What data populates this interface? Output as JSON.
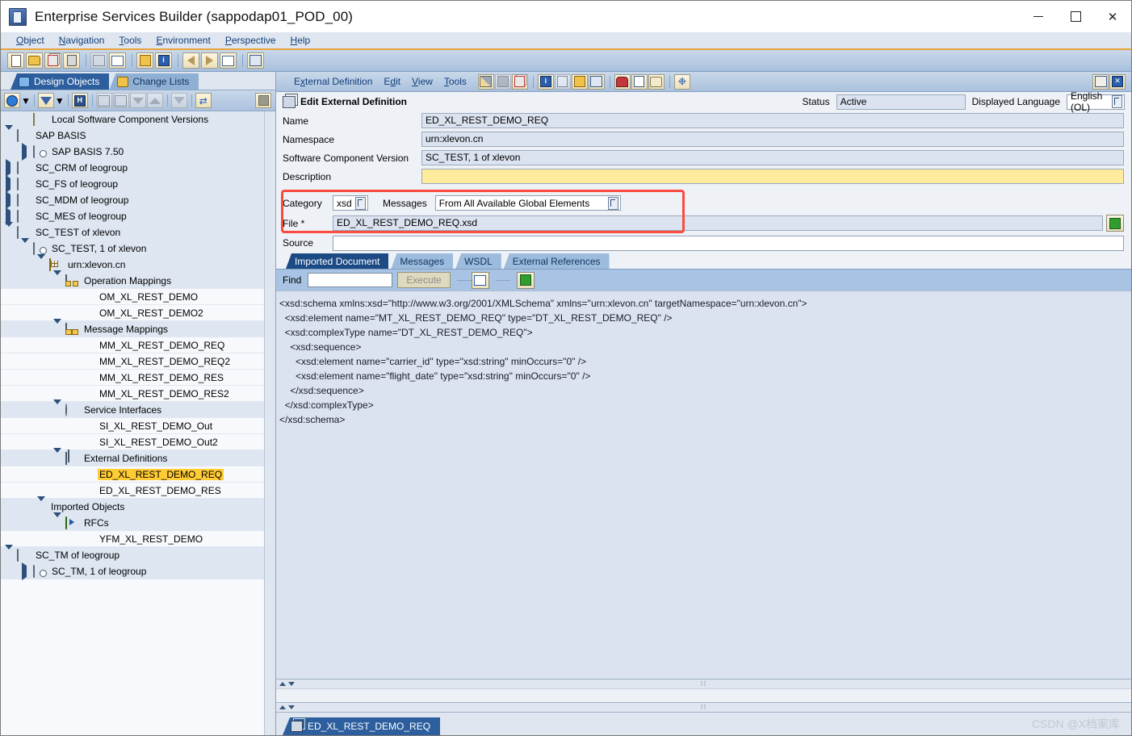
{
  "window": {
    "title": "Enterprise Services Builder (sappodap01_POD_00)",
    "minimize_label": "—",
    "maximize_label": "□",
    "close_label": "✕"
  },
  "menubar": {
    "items": [
      {
        "label": "Object",
        "accel": "O"
      },
      {
        "label": "Navigation",
        "accel": "N"
      },
      {
        "label": "Tools",
        "accel": "T"
      },
      {
        "label": "Environment",
        "accel": "E"
      },
      {
        "label": "Perspective",
        "accel": "P"
      },
      {
        "label": "Help",
        "accel": "H"
      }
    ]
  },
  "main_toolbar": {
    "buttons": [
      {
        "name": "new-icon",
        "enabled": true
      },
      {
        "name": "open-folder-icon",
        "enabled": true
      },
      {
        "name": "copy-icon",
        "enabled": true
      },
      {
        "name": "delete-trash-icon",
        "enabled": true
      },
      {
        "name": "save-all-icon",
        "enabled": false
      },
      {
        "name": "check-document-icon",
        "enabled": true
      },
      {
        "name": "where-used-icon",
        "enabled": true
      },
      {
        "name": "object-info-icon",
        "enabled": true
      },
      {
        "name": "back-arrow-icon",
        "enabled": true
      },
      {
        "name": "forward-arrow-icon",
        "enabled": true
      },
      {
        "name": "history-list-icon",
        "enabled": true
      },
      {
        "name": "cache-notification-icon",
        "enabled": true
      }
    ]
  },
  "left_panel": {
    "tabs": [
      {
        "label": "Design Objects",
        "active": true,
        "icon": "design-objects-icon"
      },
      {
        "label": "Change Lists",
        "active": false,
        "icon": "change-lists-icon"
      }
    ],
    "toolbar": [
      {
        "name": "refresh-icon",
        "enabled": true,
        "has_dropdown": true
      },
      {
        "name": "filter-icon",
        "enabled": true,
        "has_dropdown": true
      },
      {
        "name": "find-icon",
        "enabled": true
      },
      {
        "name": "expand-subtree-icon",
        "enabled": false
      },
      {
        "name": "collapse-subtree-icon",
        "enabled": false
      },
      {
        "name": "expand-all-icon",
        "enabled": false
      },
      {
        "name": "collapse-all-icon",
        "enabled": false
      },
      {
        "name": "apply-filter-icon",
        "enabled": false
      },
      {
        "name": "sync-navigation-icon",
        "enabled": true
      },
      {
        "name": "stop-icon",
        "enabled": false
      }
    ],
    "tree": [
      {
        "label": "Local Software Component Versions",
        "indent": 1,
        "arrow": "none",
        "icon": "software-stack-icon",
        "band": true
      },
      {
        "label": "SAP BASIS",
        "indent": 0,
        "arrow": "open",
        "icon": "software-component-icon",
        "band": true
      },
      {
        "label": "SAP BASIS 7.50",
        "indent": 1,
        "arrow": "closed",
        "icon": "scv-icon",
        "band": true
      },
      {
        "label": "SC_CRM of leogroup",
        "indent": 0,
        "arrow": "closed",
        "icon": "software-component-icon",
        "band": true
      },
      {
        "label": "SC_FS of leogroup",
        "indent": 0,
        "arrow": "closed",
        "icon": "software-component-icon",
        "band": true
      },
      {
        "label": "SC_MDM of leogroup",
        "indent": 0,
        "arrow": "closed",
        "icon": "software-component-icon",
        "band": true
      },
      {
        "label": "SC_MES of leogroup",
        "indent": 0,
        "arrow": "closed",
        "icon": "software-component-icon",
        "band": true
      },
      {
        "label": "SC_TEST of xlevon",
        "indent": 0,
        "arrow": "open",
        "icon": "software-component-icon",
        "band": true
      },
      {
        "label": "SC_TEST, 1 of xlevon",
        "indent": 1,
        "arrow": "open",
        "icon": "scv-icon",
        "band": true
      },
      {
        "label": "urn:xlevon.cn",
        "indent": 2,
        "arrow": "open",
        "icon": "namespace-icon",
        "band": true
      },
      {
        "label": "Operation Mappings",
        "indent": 3,
        "arrow": "open",
        "icon": "operation-mappings-icon",
        "band": true
      },
      {
        "label": "OM_XL_REST_DEMO",
        "indent": 5,
        "arrow": "none",
        "icon": "none",
        "band": false
      },
      {
        "label": "OM_XL_REST_DEMO2",
        "indent": 5,
        "arrow": "none",
        "icon": "none",
        "band": false
      },
      {
        "label": "Message Mappings",
        "indent": 3,
        "arrow": "open",
        "icon": "message-mappings-icon",
        "band": true
      },
      {
        "label": "MM_XL_REST_DEMO_REQ",
        "indent": 5,
        "arrow": "none",
        "icon": "none",
        "band": false
      },
      {
        "label": "MM_XL_REST_DEMO_REQ2",
        "indent": 5,
        "arrow": "none",
        "icon": "none",
        "band": false
      },
      {
        "label": "MM_XL_REST_DEMO_RES",
        "indent": 5,
        "arrow": "none",
        "icon": "none",
        "band": false
      },
      {
        "label": "MM_XL_REST_DEMO_RES2",
        "indent": 5,
        "arrow": "none",
        "icon": "none",
        "band": false
      },
      {
        "label": "Service Interfaces",
        "indent": 3,
        "arrow": "open",
        "icon": "service-interfaces-icon",
        "band": true
      },
      {
        "label": "SI_XL_REST_DEMO_Out",
        "indent": 5,
        "arrow": "none",
        "icon": "none",
        "band": false
      },
      {
        "label": "SI_XL_REST_DEMO_Out2",
        "indent": 5,
        "arrow": "none",
        "icon": "none",
        "band": false
      },
      {
        "label": "External Definitions",
        "indent": 3,
        "arrow": "open",
        "icon": "external-definitions-icon",
        "band": true
      },
      {
        "label": "ED_XL_REST_DEMO_REQ",
        "indent": 5,
        "arrow": "none",
        "icon": "none",
        "band": false,
        "selected": true
      },
      {
        "label": "ED_XL_REST_DEMO_RES",
        "indent": 5,
        "arrow": "none",
        "icon": "none",
        "band": false
      },
      {
        "label": "Imported Objects",
        "indent": 2,
        "arrow": "open",
        "icon": "none",
        "band": true
      },
      {
        "label": "RFCs",
        "indent": 3,
        "arrow": "open",
        "icon": "rfc-icon",
        "band": true
      },
      {
        "label": "YFM_XL_REST_DEMO",
        "indent": 5,
        "arrow": "none",
        "icon": "none",
        "band": false
      },
      {
        "label": "SC_TM of leogroup",
        "indent": 0,
        "arrow": "open",
        "icon": "software-component-icon",
        "band": true
      },
      {
        "label": "SC_TM, 1 of leogroup",
        "indent": 1,
        "arrow": "closed",
        "icon": "scv-icon",
        "band": true
      }
    ]
  },
  "editor": {
    "menu": [
      {
        "label": "External Definition",
        "accel": "x"
      },
      {
        "label": "Edit",
        "accel": "d"
      },
      {
        "label": "View",
        "accel": "V"
      },
      {
        "label": "Tools",
        "accel": "T"
      }
    ],
    "toolbar": [
      {
        "name": "edit-pencil-icon",
        "enabled": true
      },
      {
        "name": "save-disk-icon",
        "enabled": false
      },
      {
        "name": "copy-object-icon",
        "enabled": true
      },
      {
        "name": "display-info-icon",
        "enabled": true
      },
      {
        "name": "documentation-icon",
        "enabled": false
      },
      {
        "name": "where-used-list-icon",
        "enabled": true
      },
      {
        "name": "properties-icon",
        "enabled": true
      },
      {
        "name": "activate-icon",
        "enabled": true
      },
      {
        "name": "version-history-icon",
        "enabled": true
      },
      {
        "name": "log-icon",
        "enabled": true
      },
      {
        "name": "dependencies-icon",
        "enabled": true
      }
    ],
    "toolbar_right": [
      {
        "name": "pin-icon",
        "enabled": true
      },
      {
        "name": "close-editor-icon",
        "enabled": true
      }
    ],
    "header": {
      "title": "Edit External Definition",
      "status_label": "Status",
      "status_value": "Active",
      "language_label": "Displayed Language",
      "language_value": "English (OL)"
    },
    "fields": {
      "name_label": "Name",
      "name_value": "ED_XL_REST_DEMO_REQ",
      "namespace_label": "Namespace",
      "namespace_value": "urn:xlevon.cn",
      "scv_label": "Software Component Version",
      "scv_value": "SC_TEST, 1 of xlevon",
      "description_label": "Description",
      "description_value": "",
      "category_label": "Category",
      "category_value": "xsd",
      "messages_label": "Messages",
      "messages_value": "From All Available Global Elements",
      "file_label": "File *",
      "file_value": "ED_XL_REST_DEMO_REQ.xsd",
      "source_label": "Source",
      "source_value": ""
    },
    "tabs": [
      {
        "label": "Imported Document",
        "active": true
      },
      {
        "label": "Messages",
        "active": false
      },
      {
        "label": "WSDL",
        "active": false
      },
      {
        "label": "External References",
        "active": false
      }
    ],
    "findbar": {
      "find_label": "Find",
      "find_value": "",
      "execute_label": "Execute",
      "buttons": [
        {
          "name": "view-document-icon"
        },
        {
          "name": "export-document-icon"
        }
      ]
    },
    "xml_lines": [
      "<xsd:schema xmlns:xsd=\"http://www.w3.org/2001/XMLSchema\" xmlns=\"urn:xlevon.cn\" targetNamespace=\"urn:xlevon.cn\">",
      "  <xsd:element name=\"MT_XL_REST_DEMO_REQ\" type=\"DT_XL_REST_DEMO_REQ\" />",
      "  <xsd:complexType name=\"DT_XL_REST_DEMO_REQ\">",
      "    <xsd:sequence>",
      "      <xsd:element name=\"carrier_id\" type=\"xsd:string\" minOccurs=\"0\" />",
      "      <xsd:element name=\"flight_date\" type=\"xsd:string\" minOccurs=\"0\" />",
      "    </xsd:sequence>",
      "  </xsd:complexType>",
      "</xsd:schema>"
    ]
  },
  "statusbar": {
    "open_object": "ED_XL_REST_DEMO_REQ",
    "watermark": "CSDN @X档案库"
  },
  "colors": {
    "accent_orange": "#e8a33d",
    "selection_yellow": "#ffcc33",
    "highlight_red": "#fb4a3e",
    "tab_active_blue": "#1c4a85",
    "field_readonly": "#dbe3f0",
    "field_required_yellow": "#ffeb9c"
  }
}
